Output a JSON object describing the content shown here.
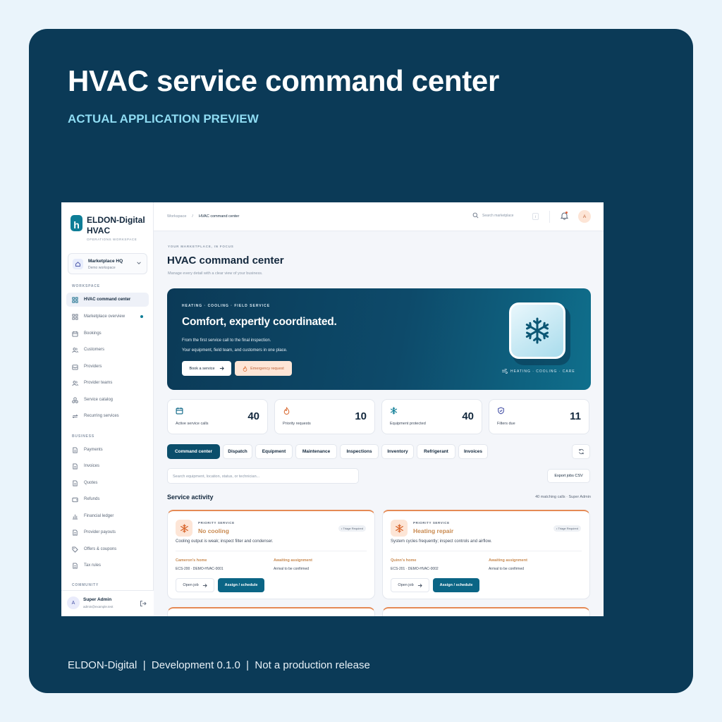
{
  "poster": {
    "title": "HVAC service command center",
    "subtitle": "ACTUAL APPLICATION PREVIEW",
    "footer": "ELDON-Digital  |  Development 0.1.0  |  Not a production release"
  },
  "brand": {
    "name": "ELDON-Digital HVAC",
    "sub": "OPERATIONS WORKSPACE",
    "logo_letter": "h"
  },
  "workspace_switcher": {
    "name": "Marketplace HQ",
    "desc": "Demo workspace"
  },
  "sidebar": {
    "workspace_label": "WORKSPACE",
    "workspace_items": [
      {
        "label": "HVAC command center",
        "icon": "grid-icon"
      },
      {
        "label": "Marketplace overview",
        "icon": "grid-icon"
      },
      {
        "label": "Bookings",
        "icon": "calendar-icon"
      },
      {
        "label": "Customers",
        "icon": "users-icon"
      },
      {
        "label": "Providers",
        "icon": "inbox-icon"
      },
      {
        "label": "Provider teams",
        "icon": "users-icon"
      },
      {
        "label": "Service catalog",
        "icon": "shapes-icon"
      },
      {
        "label": "Recurring services",
        "icon": "repeat-icon"
      }
    ],
    "business_label": "BUSINESS",
    "business_items": [
      {
        "label": "Payments",
        "icon": "document-icon"
      },
      {
        "label": "Invoices",
        "icon": "document-icon"
      },
      {
        "label": "Quotes",
        "icon": "document-icon"
      },
      {
        "label": "Refunds",
        "icon": "wallet-icon"
      },
      {
        "label": "Financial ledger",
        "icon": "bar-chart-icon"
      },
      {
        "label": "Provider payouts",
        "icon": "document-icon"
      },
      {
        "label": "Offers & coupons",
        "icon": "tag-icon"
      },
      {
        "label": "Tax rules",
        "icon": "document-icon"
      }
    ],
    "community_label": "COMMUNITY"
  },
  "user": {
    "initial": "A",
    "name": "Super Admin",
    "email": "admin@example.test"
  },
  "topbar": {
    "breadcrumb_root": "Workspace",
    "breadcrumb_sep": "/",
    "breadcrumb_current": "HVAC command center",
    "search_placeholder": "Search marketplace",
    "search_kbd": "/",
    "avatar_initial": "A"
  },
  "page": {
    "eyebrow": "YOUR MARKETPLACE, IN FOCUS",
    "title": "HVAC command center",
    "desc": "Manage every detail with a clear view of your business."
  },
  "hero": {
    "eyebrow": "HEATING · COOLING · FIELD SERVICE",
    "title": "Comfort, expertly coordinated.",
    "line1": "From the first service call to the final inspection.",
    "line2": "Your equipment, field team, and customers in one place.",
    "primary_button": "Book a service",
    "secondary_button": "Emergency request",
    "caption": "HEATING · COOLING · CARE"
  },
  "stats": [
    {
      "label": "Active service calls",
      "value": "40",
      "icon": "calendar-icon",
      "color": "#0b6585"
    },
    {
      "label": "Priority requests",
      "value": "10",
      "icon": "flame-icon",
      "color": "#d9682f"
    },
    {
      "label": "Equipment protected",
      "value": "40",
      "icon": "snowflake-icon",
      "color": "#0e7d96"
    },
    {
      "label": "Filters due",
      "value": "11",
      "icon": "shield-icon",
      "color": "#4a55a8"
    }
  ],
  "tabs": [
    "Command center",
    "Dispatch",
    "Equipment",
    "Maintenance",
    "Inspections",
    "Inventory",
    "Refrigerant",
    "Invoices"
  ],
  "search": {
    "placeholder": "Search equipment, location, status, or technician..."
  },
  "export_button": "Export jobs CSV",
  "activity": {
    "title": "Service activity",
    "meta": "40 matching calls · Super Admin"
  },
  "cards": [
    {
      "eyebrow": "PRIORITY SERVICE",
      "title": "No cooling",
      "badge": "• Triage Required",
      "desc": "Cooling output is weak; inspect filter and condenser.",
      "customer": "Cameron's home",
      "ref": "ECS-200 · DEMO-HVAC-0001",
      "status": "Awaiting assignment",
      "status_detail": "Arrival to be confirmed",
      "open_label": "Open job",
      "assign_label": "Assign / schedule"
    },
    {
      "eyebrow": "PRIORITY SERVICE",
      "title": "Heating repair",
      "badge": "• Triage Required",
      "desc": "System cycles frequently; inspect controls and airflow.",
      "customer": "Quinn's home",
      "ref": "ECS-201 · DEMO-HVAC-0002",
      "status": "Awaiting assignment",
      "status_detail": "Arrival to be confirmed",
      "open_label": "Open job",
      "assign_label": "Assign / schedule"
    }
  ]
}
